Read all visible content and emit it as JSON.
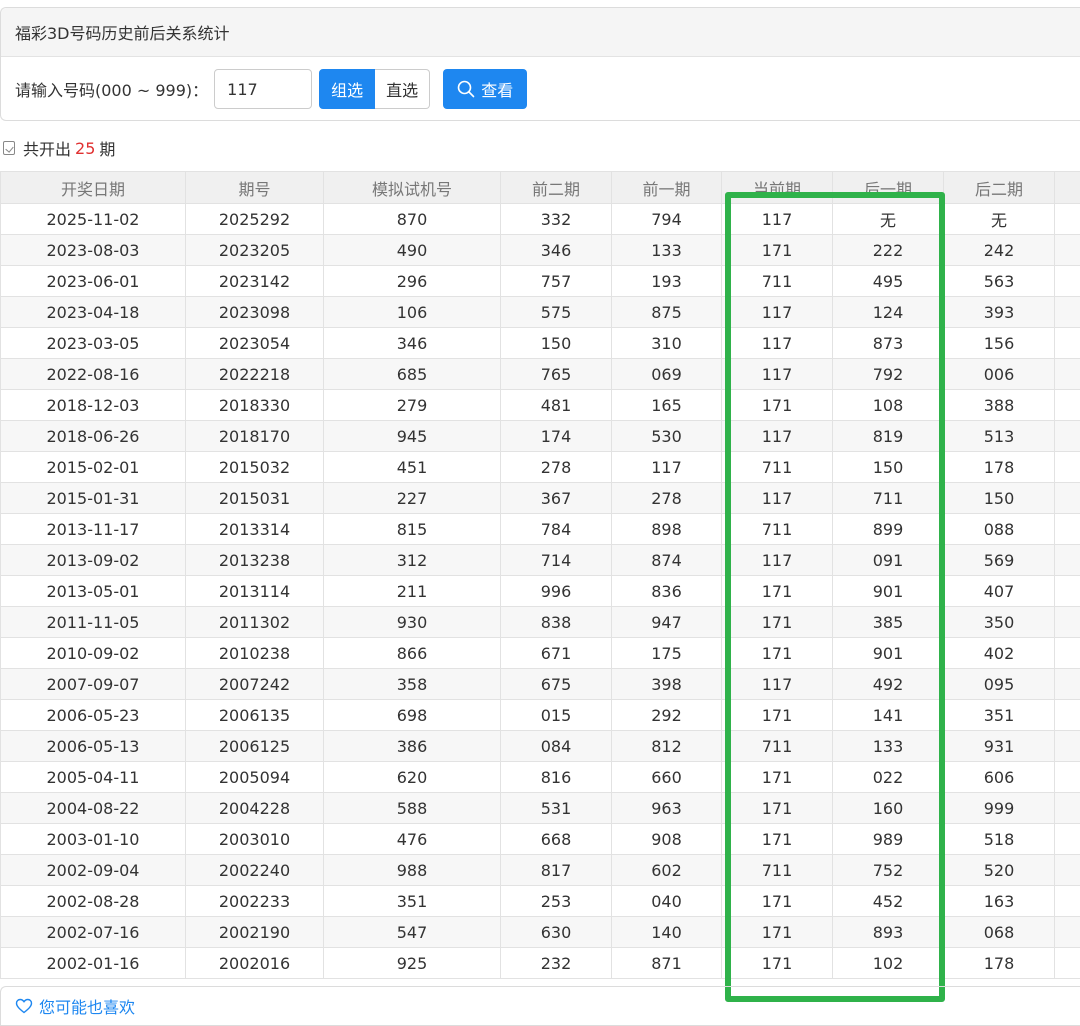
{
  "panel": {
    "title": "福彩3D号码历史前后关系统计",
    "input_label": "请输入号码(000 ~ 999)：",
    "input_value": "117",
    "mode_group": "组选",
    "mode_direct": "直选",
    "query_label": "查看"
  },
  "summary": {
    "prefix": "共开出",
    "count": "25",
    "suffix": "期"
  },
  "table": {
    "headers": [
      "开奖日期",
      "期号",
      "模拟试机号",
      "前二期",
      "前一期",
      "当前期",
      "后一期",
      "后二期",
      ""
    ],
    "rows": [
      [
        "2025-11-02",
        "2025292",
        "870",
        "332",
        "794",
        "117",
        "无",
        "无"
      ],
      [
        "2023-08-03",
        "2023205",
        "490",
        "346",
        "133",
        "171",
        "222",
        "242"
      ],
      [
        "2023-06-01",
        "2023142",
        "296",
        "757",
        "193",
        "711",
        "495",
        "563"
      ],
      [
        "2023-04-18",
        "2023098",
        "106",
        "575",
        "875",
        "117",
        "124",
        "393"
      ],
      [
        "2023-03-05",
        "2023054",
        "346",
        "150",
        "310",
        "117",
        "873",
        "156"
      ],
      [
        "2022-08-16",
        "2022218",
        "685",
        "765",
        "069",
        "117",
        "792",
        "006"
      ],
      [
        "2018-12-03",
        "2018330",
        "279",
        "481",
        "165",
        "171",
        "108",
        "388"
      ],
      [
        "2018-06-26",
        "2018170",
        "945",
        "174",
        "530",
        "117",
        "819",
        "513"
      ],
      [
        "2015-02-01",
        "2015032",
        "451",
        "278",
        "117",
        "711",
        "150",
        "178"
      ],
      [
        "2015-01-31",
        "2015031",
        "227",
        "367",
        "278",
        "117",
        "711",
        "150"
      ],
      [
        "2013-11-17",
        "2013314",
        "815",
        "784",
        "898",
        "711",
        "899",
        "088"
      ],
      [
        "2013-09-02",
        "2013238",
        "312",
        "714",
        "874",
        "117",
        "091",
        "569"
      ],
      [
        "2013-05-01",
        "2013114",
        "211",
        "996",
        "836",
        "171",
        "901",
        "407"
      ],
      [
        "2011-11-05",
        "2011302",
        "930",
        "838",
        "947",
        "171",
        "385",
        "350"
      ],
      [
        "2010-09-02",
        "2010238",
        "866",
        "671",
        "175",
        "171",
        "901",
        "402"
      ],
      [
        "2007-09-07",
        "2007242",
        "358",
        "675",
        "398",
        "117",
        "492",
        "095"
      ],
      [
        "2006-05-23",
        "2006135",
        "698",
        "015",
        "292",
        "171",
        "141",
        "351"
      ],
      [
        "2006-05-13",
        "2006125",
        "386",
        "084",
        "812",
        "711",
        "133",
        "931"
      ],
      [
        "2005-04-11",
        "2005094",
        "620",
        "816",
        "660",
        "171",
        "022",
        "606"
      ],
      [
        "2004-08-22",
        "2004228",
        "588",
        "531",
        "963",
        "171",
        "160",
        "999"
      ],
      [
        "2003-01-10",
        "2003010",
        "476",
        "668",
        "908",
        "171",
        "989",
        "518"
      ],
      [
        "2002-09-04",
        "2002240",
        "988",
        "817",
        "602",
        "711",
        "752",
        "520"
      ],
      [
        "2002-08-28",
        "2002233",
        "351",
        "253",
        "040",
        "171",
        "452",
        "163"
      ],
      [
        "2002-07-16",
        "2002190",
        "547",
        "630",
        "140",
        "171",
        "893",
        "068"
      ],
      [
        "2002-01-16",
        "2002016",
        "925",
        "232",
        "871",
        "171",
        "102",
        "178"
      ]
    ]
  },
  "recommend": {
    "label": "您可能也喜欢"
  },
  "colors": {
    "accent": "#1e87f0",
    "highlight": "#2fb24a",
    "count": "#e03030"
  }
}
